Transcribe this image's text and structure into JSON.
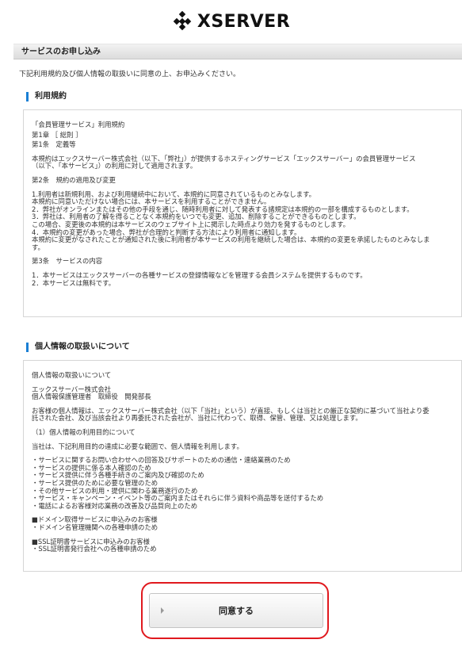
{
  "brand": {
    "name": "XSERVER"
  },
  "section_title": "サービスのお申し込み",
  "intro": "下記利用規約及び個人情報の取扱いに同意の上、お申込みください。",
  "terms": {
    "heading": "利用規約",
    "lines": [
      "「会員管理サービス」利用規約",
      "第1章 ［ 総則 ］",
      "第1条　定義等",
      "本規約はエックスサーバー株式会社（以下、「弊社」）が提供するホスティングサービス「エックスサーバー」の会員管理サービス\n（以下、「本サービス」）の利用に対して適用されます。",
      "第2条　規約の適用及び変更",
      "1.利用者は新規利用、および利用継続中において、本規約に同意されているものとみなします。\n本規約に同意いただけない場合には、本サービスを利用することができません。\n2．弊社がオンラインまたはその他の手段を通じ、随時利用者に対して発表する諸規定は本規約の一部を構成するものとします。\n3．弊社は、利用者の了解を得ることなく本規約をいつでも変更、追加、削除することができるものとします。\nこの場合、変更後の本規約は本サービスのウェブサイト上に掲示した時点より効力を発するものとします。\n4．本規約の変更があった場合、弊社が合理的と判断する方法により利用者に通知します。\n本規約に変更がなされたことが通知された後に利用者が本サービスの利用を継続した場合は、本規約の変更を承諾したものとみなしま\nす。",
      "第3条　サービスの内容",
      "1．本サービスはエックスサーバーの各種サービスの登録情報などを管理する会員システムを提供するものです。\n2．本サービスは無料です。"
    ]
  },
  "privacy": {
    "heading": "個人情報の取扱いについて",
    "lines": [
      "個人情報の取扱いについて",
      "エックスサーバー株式会社\n個人情報保護管理者　取締役　開発部長",
      "お客様の個人情報は、エックスサーバー株式会社（以下「当社」という）が直接、もしくは当社との厳正な契約に基づいて当社より委\n託された会社、及び当該会社より再委託された会社が、当社に代わって、取得、保管、管理、又は処理します。",
      "（1）個人情報の利用目的について",
      "当社は、下記利用目的の達成に必要な範囲で、個人情報を利用します。",
      "・サービスに関するお問い合わせへの回答及びサポートのための通信・連絡業務のため\n・サービスの提供に係る本人確認のため\n・サービス提供に伴う各種手続きのご案内及び確認のため\n・サービス提供のために必要な管理のため\n・その他サービスの利用・提供に関わる業務遂行のため\n・サービス・キャンペーン・イベント等のご案内またはそれらに伴う資料や商品等を送付するため\n・電話によるお客様対応業務の改善及び品質向上のため",
      "■ドメイン取得サービスに申込みのお客様\n・ドメイン名管理機関への各種申請のため",
      "■SSL証明書サービスに申込みのお客様\n・SSL証明書発行会社への各種申請のため"
    ]
  },
  "agree_button": {
    "label": "同意する"
  }
}
